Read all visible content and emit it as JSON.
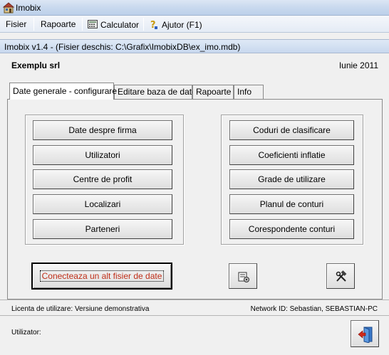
{
  "window": {
    "title": "Imobix"
  },
  "menu": {
    "fisier": "Fisier",
    "rapoarte": "Rapoarte",
    "calculator": "Calculator",
    "ajutor": "Ajutor (F1)"
  },
  "document": {
    "title": "Imobix v1.4 - (Fisier deschis: C:\\Grafix\\ImobixDB\\ex_imo.mdb)"
  },
  "company": "Exemplu srl",
  "period": "Iunie 2011",
  "tabs": [
    {
      "label": "Date generale - configurare",
      "active": true
    },
    {
      "label": "Editare baza de date",
      "active": false
    },
    {
      "label": "Rapoarte",
      "active": false
    },
    {
      "label": "Info",
      "active": false
    }
  ],
  "left_buttons": [
    "Date despre firma",
    "Utilizatori",
    "Centre de profit",
    "Localizari",
    "Parteneri"
  ],
  "right_buttons": [
    "Coduri de clasificare",
    "Coeficienti inflatie",
    "Grade de utilizare",
    "Planul de conturi",
    "Corespondente conturi"
  ],
  "connect_button": "Conecteaza un alt fisier de date",
  "icons": {
    "app": "building-icon",
    "calculator": "calculator-icon",
    "help": "help-icon",
    "tools": "tools-icon",
    "settings": "document-settings-icon",
    "exit": "exit-door-icon"
  },
  "status": {
    "licenta": "Licenta de utilizare: Versiune demonstrativa",
    "network": "Network ID: Sebastian, SEBASTIAN-PC",
    "utilizator": "Utilizator:"
  },
  "colors": {
    "accent_link": "#c0301a",
    "header_bar": "#c8d8ee"
  }
}
